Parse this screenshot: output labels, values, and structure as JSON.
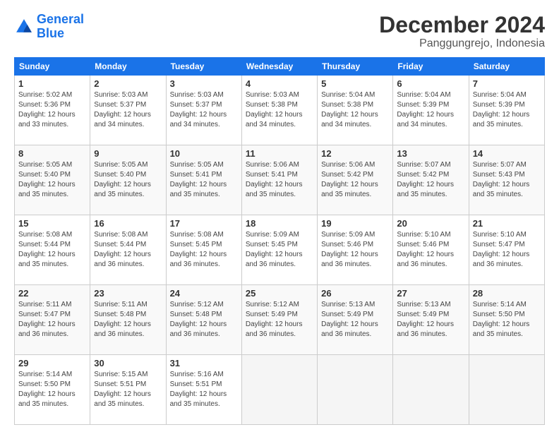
{
  "logo": {
    "line1": "General",
    "line2": "Blue"
  },
  "title": "December 2024",
  "subtitle": "Panggungrejo, Indonesia",
  "weekdays": [
    "Sunday",
    "Monday",
    "Tuesday",
    "Wednesday",
    "Thursday",
    "Friday",
    "Saturday"
  ],
  "weeks": [
    [
      {
        "day": "1",
        "info": "Sunrise: 5:02 AM\nSunset: 5:36 PM\nDaylight: 12 hours\nand 33 minutes."
      },
      {
        "day": "2",
        "info": "Sunrise: 5:03 AM\nSunset: 5:37 PM\nDaylight: 12 hours\nand 34 minutes."
      },
      {
        "day": "3",
        "info": "Sunrise: 5:03 AM\nSunset: 5:37 PM\nDaylight: 12 hours\nand 34 minutes."
      },
      {
        "day": "4",
        "info": "Sunrise: 5:03 AM\nSunset: 5:38 PM\nDaylight: 12 hours\nand 34 minutes."
      },
      {
        "day": "5",
        "info": "Sunrise: 5:04 AM\nSunset: 5:38 PM\nDaylight: 12 hours\nand 34 minutes."
      },
      {
        "day": "6",
        "info": "Sunrise: 5:04 AM\nSunset: 5:39 PM\nDaylight: 12 hours\nand 34 minutes."
      },
      {
        "day": "7",
        "info": "Sunrise: 5:04 AM\nSunset: 5:39 PM\nDaylight: 12 hours\nand 35 minutes."
      }
    ],
    [
      {
        "day": "8",
        "info": "Sunrise: 5:05 AM\nSunset: 5:40 PM\nDaylight: 12 hours\nand 35 minutes."
      },
      {
        "day": "9",
        "info": "Sunrise: 5:05 AM\nSunset: 5:40 PM\nDaylight: 12 hours\nand 35 minutes."
      },
      {
        "day": "10",
        "info": "Sunrise: 5:05 AM\nSunset: 5:41 PM\nDaylight: 12 hours\nand 35 minutes."
      },
      {
        "day": "11",
        "info": "Sunrise: 5:06 AM\nSunset: 5:41 PM\nDaylight: 12 hours\nand 35 minutes."
      },
      {
        "day": "12",
        "info": "Sunrise: 5:06 AM\nSunset: 5:42 PM\nDaylight: 12 hours\nand 35 minutes."
      },
      {
        "day": "13",
        "info": "Sunrise: 5:07 AM\nSunset: 5:42 PM\nDaylight: 12 hours\nand 35 minutes."
      },
      {
        "day": "14",
        "info": "Sunrise: 5:07 AM\nSunset: 5:43 PM\nDaylight: 12 hours\nand 35 minutes."
      }
    ],
    [
      {
        "day": "15",
        "info": "Sunrise: 5:08 AM\nSunset: 5:44 PM\nDaylight: 12 hours\nand 35 minutes."
      },
      {
        "day": "16",
        "info": "Sunrise: 5:08 AM\nSunset: 5:44 PM\nDaylight: 12 hours\nand 36 minutes."
      },
      {
        "day": "17",
        "info": "Sunrise: 5:08 AM\nSunset: 5:45 PM\nDaylight: 12 hours\nand 36 minutes."
      },
      {
        "day": "18",
        "info": "Sunrise: 5:09 AM\nSunset: 5:45 PM\nDaylight: 12 hours\nand 36 minutes."
      },
      {
        "day": "19",
        "info": "Sunrise: 5:09 AM\nSunset: 5:46 PM\nDaylight: 12 hours\nand 36 minutes."
      },
      {
        "day": "20",
        "info": "Sunrise: 5:10 AM\nSunset: 5:46 PM\nDaylight: 12 hours\nand 36 minutes."
      },
      {
        "day": "21",
        "info": "Sunrise: 5:10 AM\nSunset: 5:47 PM\nDaylight: 12 hours\nand 36 minutes."
      }
    ],
    [
      {
        "day": "22",
        "info": "Sunrise: 5:11 AM\nSunset: 5:47 PM\nDaylight: 12 hours\nand 36 minutes."
      },
      {
        "day": "23",
        "info": "Sunrise: 5:11 AM\nSunset: 5:48 PM\nDaylight: 12 hours\nand 36 minutes."
      },
      {
        "day": "24",
        "info": "Sunrise: 5:12 AM\nSunset: 5:48 PM\nDaylight: 12 hours\nand 36 minutes."
      },
      {
        "day": "25",
        "info": "Sunrise: 5:12 AM\nSunset: 5:49 PM\nDaylight: 12 hours\nand 36 minutes."
      },
      {
        "day": "26",
        "info": "Sunrise: 5:13 AM\nSunset: 5:49 PM\nDaylight: 12 hours\nand 36 minutes."
      },
      {
        "day": "27",
        "info": "Sunrise: 5:13 AM\nSunset: 5:49 PM\nDaylight: 12 hours\nand 36 minutes."
      },
      {
        "day": "28",
        "info": "Sunrise: 5:14 AM\nSunset: 5:50 PM\nDaylight: 12 hours\nand 35 minutes."
      }
    ],
    [
      {
        "day": "29",
        "info": "Sunrise: 5:14 AM\nSunset: 5:50 PM\nDaylight: 12 hours\nand 35 minutes."
      },
      {
        "day": "30",
        "info": "Sunrise: 5:15 AM\nSunset: 5:51 PM\nDaylight: 12 hours\nand 35 minutes."
      },
      {
        "day": "31",
        "info": "Sunrise: 5:16 AM\nSunset: 5:51 PM\nDaylight: 12 hours\nand 35 minutes."
      },
      null,
      null,
      null,
      null
    ]
  ]
}
